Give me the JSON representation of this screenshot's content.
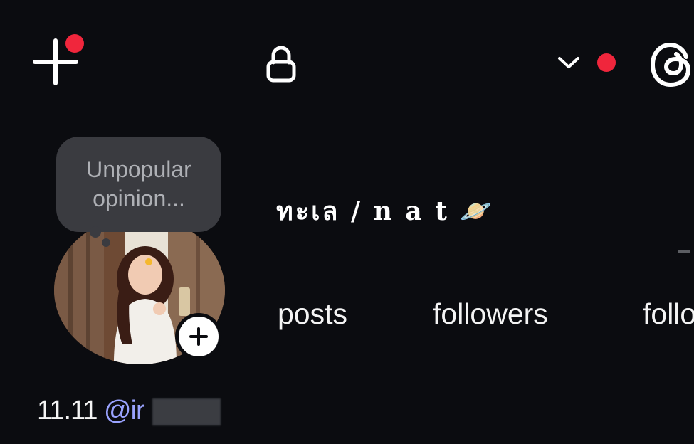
{
  "top_bar": {
    "create_icon": "plus-icon",
    "notification_color": "#f0263c",
    "privacy_icon": "lock-icon",
    "account_switcher_icon": "chevron-down-icon",
    "threads_icon": "threads-logo-icon"
  },
  "note": {
    "text": "Unpopular\nopinion..."
  },
  "profile": {
    "display_name": "ทะเล / n a t 🪐",
    "stats": {
      "posts_label": "posts",
      "followers_label": "followers",
      "following_label": "follo"
    },
    "bio": {
      "prefix": "11.11",
      "threads_handle": "@ir"
    },
    "accent_handle_color": "#9aa3ff"
  }
}
